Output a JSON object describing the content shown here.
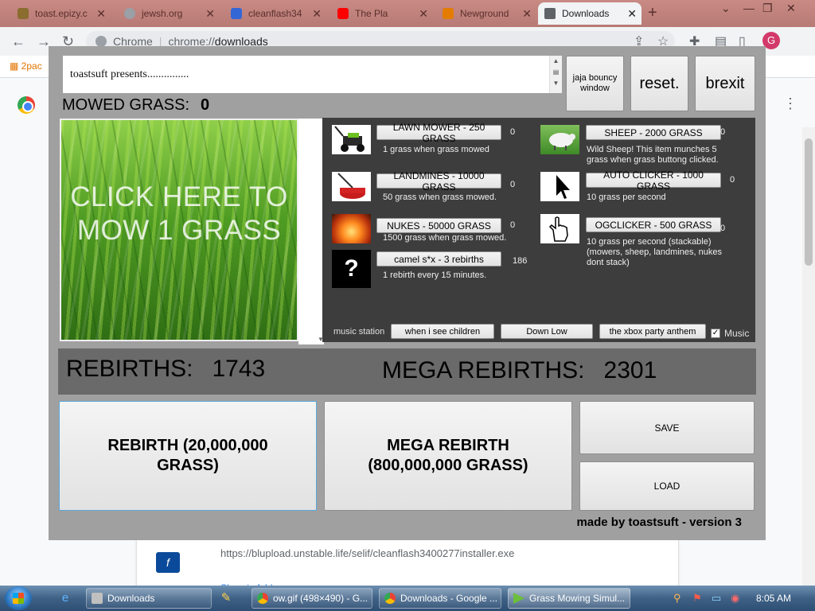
{
  "browser": {
    "tabs": [
      {
        "title": "toast.epizy.c",
        "favicon_color": "#8a6d2f"
      },
      {
        "title": "jewsh.org",
        "favicon_color": "#9aa0a6"
      },
      {
        "title": "cleanflash34",
        "favicon_color": "#3367d6"
      },
      {
        "title": "The Pla",
        "favicon_color": "#ff0000"
      },
      {
        "title": "Newground",
        "favicon_color": "#e37c00"
      },
      {
        "title": "Downloads",
        "favicon_color": "#5f6368"
      }
    ],
    "window_controls": {
      "minimize": "—",
      "restore": "❐",
      "close": "✕"
    },
    "new_tab": "+",
    "omnibox": {
      "site": "Chrome",
      "url_prefix": "chrome://",
      "url_path": "downloads"
    },
    "profile_initial": "G",
    "bookmark": "2pac"
  },
  "downloads_page": {
    "download_url": "https://blupload.unstable.life/selif/cleanflash3400277installer.exe",
    "show_in_folder": "Show in folder",
    "file_icon_glyph": "f"
  },
  "game": {
    "textbox_text": "toastsuft presents...............",
    "buttons": {
      "bouncy": "jaja bouncy window",
      "reset": "reset.",
      "brexit": "brexit"
    },
    "mowed_label": "MOWED GRASS:",
    "mowed_value": "0",
    "click_text": "CLICK HERE TO MOW 1 GRASS",
    "shop_items": [
      {
        "label": "LAWN MOWER - 250 GRASS",
        "desc": "1 grass when grass mowed",
        "owned": "0"
      },
      {
        "label": "LANDMINES - 10000 GRASS",
        "desc": "50 grass when grass mowed.",
        "owned": "0"
      },
      {
        "label": "NUKES - 50000 GRASS",
        "desc": "1500 grass when grass mowed.",
        "owned": "0"
      },
      {
        "label": "camel s*x - 3 rebirths",
        "desc": "1 rebirth every 15 minutes.",
        "owned": "186"
      },
      {
        "label": "SHEEP - 2000 GRASS",
        "desc": "Wild Sheep! This item munches 5 grass when grass buttong clicked.",
        "owned": "0"
      },
      {
        "label": "AUTO CLICKER - 1000 GRASS",
        "desc": "10 grass per second",
        "owned": "0"
      },
      {
        "label": "OGCLICKER - 500 GRASS",
        "desc": "10 grass per second (stackable) (mowers, sheep, landmines, nukes dont stack)",
        "owned": "0"
      }
    ],
    "mystery_icon": "?",
    "music": {
      "label": "music station",
      "songs": [
        "when i see children",
        "Down Low",
        "the xbox party anthem"
      ],
      "checkbox_label": "Music",
      "checked": true
    },
    "rebirths_label": "REBIRTHS:",
    "rebirths_value": "1743",
    "mega_label": "MEGA REBIRTHS:",
    "mega_value": "2301",
    "rebirth_button": "REBIRTH (20,000,000 GRASS)",
    "mega_button": "MEGA REBIRTH (800,000,000 GRASS)",
    "save": "SAVE",
    "load": "LOAD",
    "made_by": "made by toastsuft - version 3"
  },
  "taskbar": {
    "items": [
      {
        "title": "Downloads",
        "icon_color": "#c0c0c0"
      },
      {
        "title": "ow.gif (498×490) - G...",
        "icon_color": "#4285f4"
      },
      {
        "title": "Downloads - Google ...",
        "icon_color": "#4285f4"
      },
      {
        "title": "Grass Mowing Simul...",
        "icon_color": "#6cbf3b"
      }
    ],
    "clock": "8:05 AM"
  },
  "colors": {
    "game_bg": "#a0a0a0",
    "shop_bg": "#3d3d3d",
    "rebirth_bar": "#6a6a6a",
    "tabstrip": "#c98a84"
  }
}
